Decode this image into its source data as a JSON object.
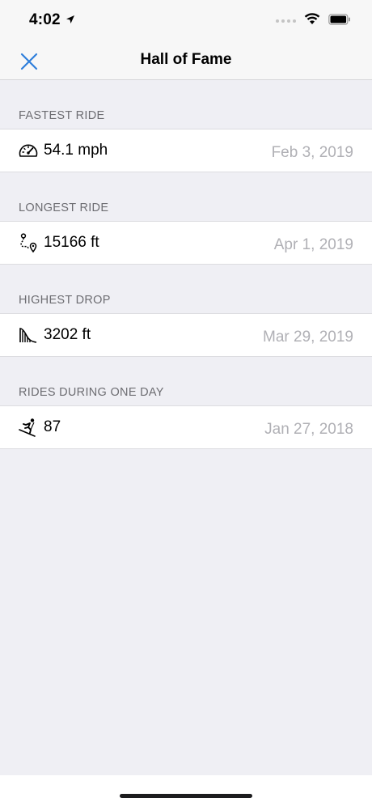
{
  "status_bar": {
    "time": "4:02"
  },
  "nav": {
    "title": "Hall of Fame",
    "close_icon": "close-icon",
    "accent_color": "#2f7fdb"
  },
  "records": [
    {
      "header": "FASTEST RIDE",
      "icon": "speedometer-icon",
      "value": "54.1 mph",
      "date": "Feb 3, 2019"
    },
    {
      "header": "LONGEST RIDE",
      "icon": "route-icon",
      "value": "15166 ft",
      "date": "Apr 1, 2019"
    },
    {
      "header": "HIGHEST DROP",
      "icon": "slope-icon",
      "value": "3202 ft",
      "date": "Mar 29, 2019"
    },
    {
      "header": "RIDES DURING ONE DAY",
      "icon": "skier-icon",
      "value": "87",
      "date": "Jan 27, 2018"
    }
  ]
}
